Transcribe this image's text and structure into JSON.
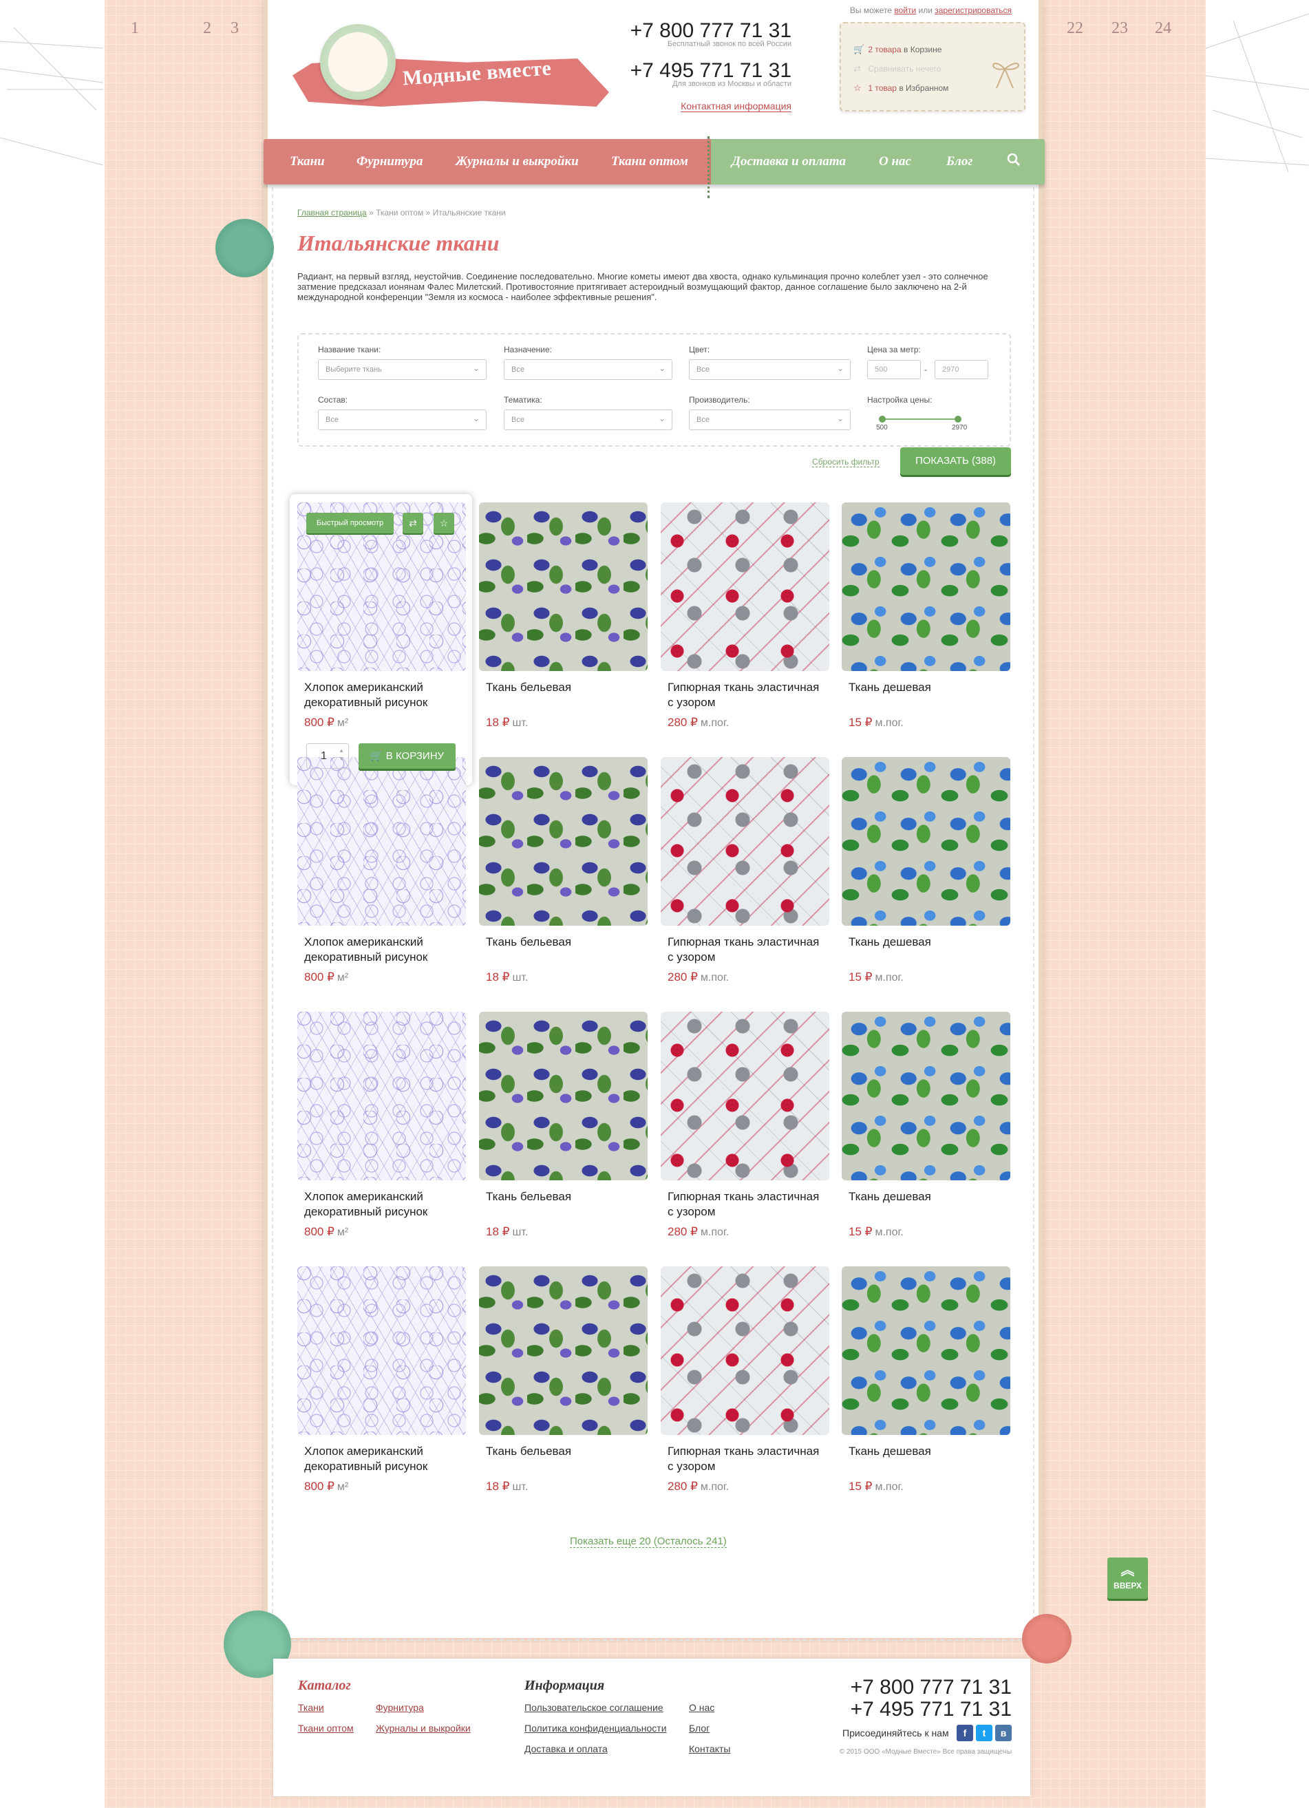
{
  "ruler": {
    "left": [
      "1",
      "2",
      "3"
    ],
    "right": [
      "22",
      "23",
      "24"
    ]
  },
  "header": {
    "logo_text": "Модные вместе",
    "phone1": "+7 800 777 71 31",
    "phone1_sub": "Бесплатный звонок по всей России",
    "phone2": "+7 495 771 71 31",
    "phone2_sub": "Для звонков из Москвы и области",
    "contact_link": "Контактная информация",
    "login_prefix": "Вы можете",
    "login_link": "войти",
    "login_mid": "или",
    "register_link": "зарегистрироваться",
    "cart_link": "2 товара",
    "cart_suffix": "в Корзине",
    "compare_text": "Сравнивать нечего",
    "fav_link": "1 товар",
    "fav_suffix": "в Избранном"
  },
  "nav": {
    "items_left": [
      "Ткани",
      "Фурнитура",
      "Журналы и выкройки",
      "Ткани оптом"
    ],
    "items_right": [
      "Доставка и оплата",
      "О нас",
      "Блог"
    ],
    "search_icon": "search-icon"
  },
  "breadcrumb": {
    "home": "Главная страница",
    "sep": "»",
    "level2": "Ткани оптом",
    "current": "Итальянские ткани"
  },
  "page": {
    "title": "Итальянские ткани",
    "description": "Радиант, на первый взгляд, неустойчив. Соединение последовательно. Многие кометы имеют два хвоста, однако кульминация прочно колеблет узел - это солнечное затмение предсказал ионянам Фалес Милетский. Противостояние притягивает астероидный возмущающий фактор, данное соглашение было заключено на 2-й международной конференции \"Земля из космоса - наиболее эффективные решения\"."
  },
  "filter": {
    "name_label": "Название ткани:",
    "name_value": "Выберите ткань",
    "purpose_label": "Назначение:",
    "purpose_value": "Все",
    "color_label": "Цвет:",
    "color_value": "Все",
    "price_label": "Цена за метр:",
    "price_from": "500",
    "price_dash": "-",
    "price_to": "2970",
    "composition_label": "Состав:",
    "composition_value": "Все",
    "theme_label": "Тематика:",
    "theme_value": "Все",
    "maker_label": "Производитель:",
    "maker_value": "Все",
    "price_setting_label": "Настройка цены:",
    "slider_min": "500",
    "slider_max": "2970",
    "reset": "Сбросить фильтр",
    "show": "ПОКАЗАТЬ (388)"
  },
  "hover": {
    "quick_view": "Быстрый просмотр",
    "qty": "1",
    "to_cart": "В КОРЗИНУ"
  },
  "products": [
    {
      "name": "Хлопок американский декоративный рисунок",
      "price": "800 ₽",
      "unit": "м²"
    },
    {
      "name": "Ткань бельевая",
      "price": "18 ₽",
      "unit": "шт."
    },
    {
      "name": "Гипюрная ткань эластичная с узором",
      "price": "280 ₽",
      "unit": "м.пог."
    },
    {
      "name": "Ткань дешевая",
      "price": "15 ₽",
      "unit": "м.пог."
    }
  ],
  "more": "Показать еще 20 (Осталось 241)",
  "up": "ВВЕРХ",
  "footer": {
    "catalog_title": "Каталог",
    "catalog_links": [
      "Ткани",
      "Фурнитура",
      "Ткани оптом",
      "Журналы и выкройки"
    ],
    "info_title": "Информация",
    "info_links": [
      "Пользовательское соглашение",
      "О нас",
      "Политика конфиденциальности",
      "Блог",
      "Доставка и оплата",
      "Контакты"
    ],
    "phone1": "+7 800 777 71 31",
    "phone2": "+7 495 771 71 31",
    "join": "Присоединяйтесь к нам",
    "social": [
      "f",
      "t",
      "в"
    ],
    "copyright": "© 2015 ООО «Модные Вместе» Все права защищены"
  },
  "colors": {
    "accent_red": "#d9807a",
    "accent_green": "#6fb160",
    "background": "#f9dccb"
  }
}
